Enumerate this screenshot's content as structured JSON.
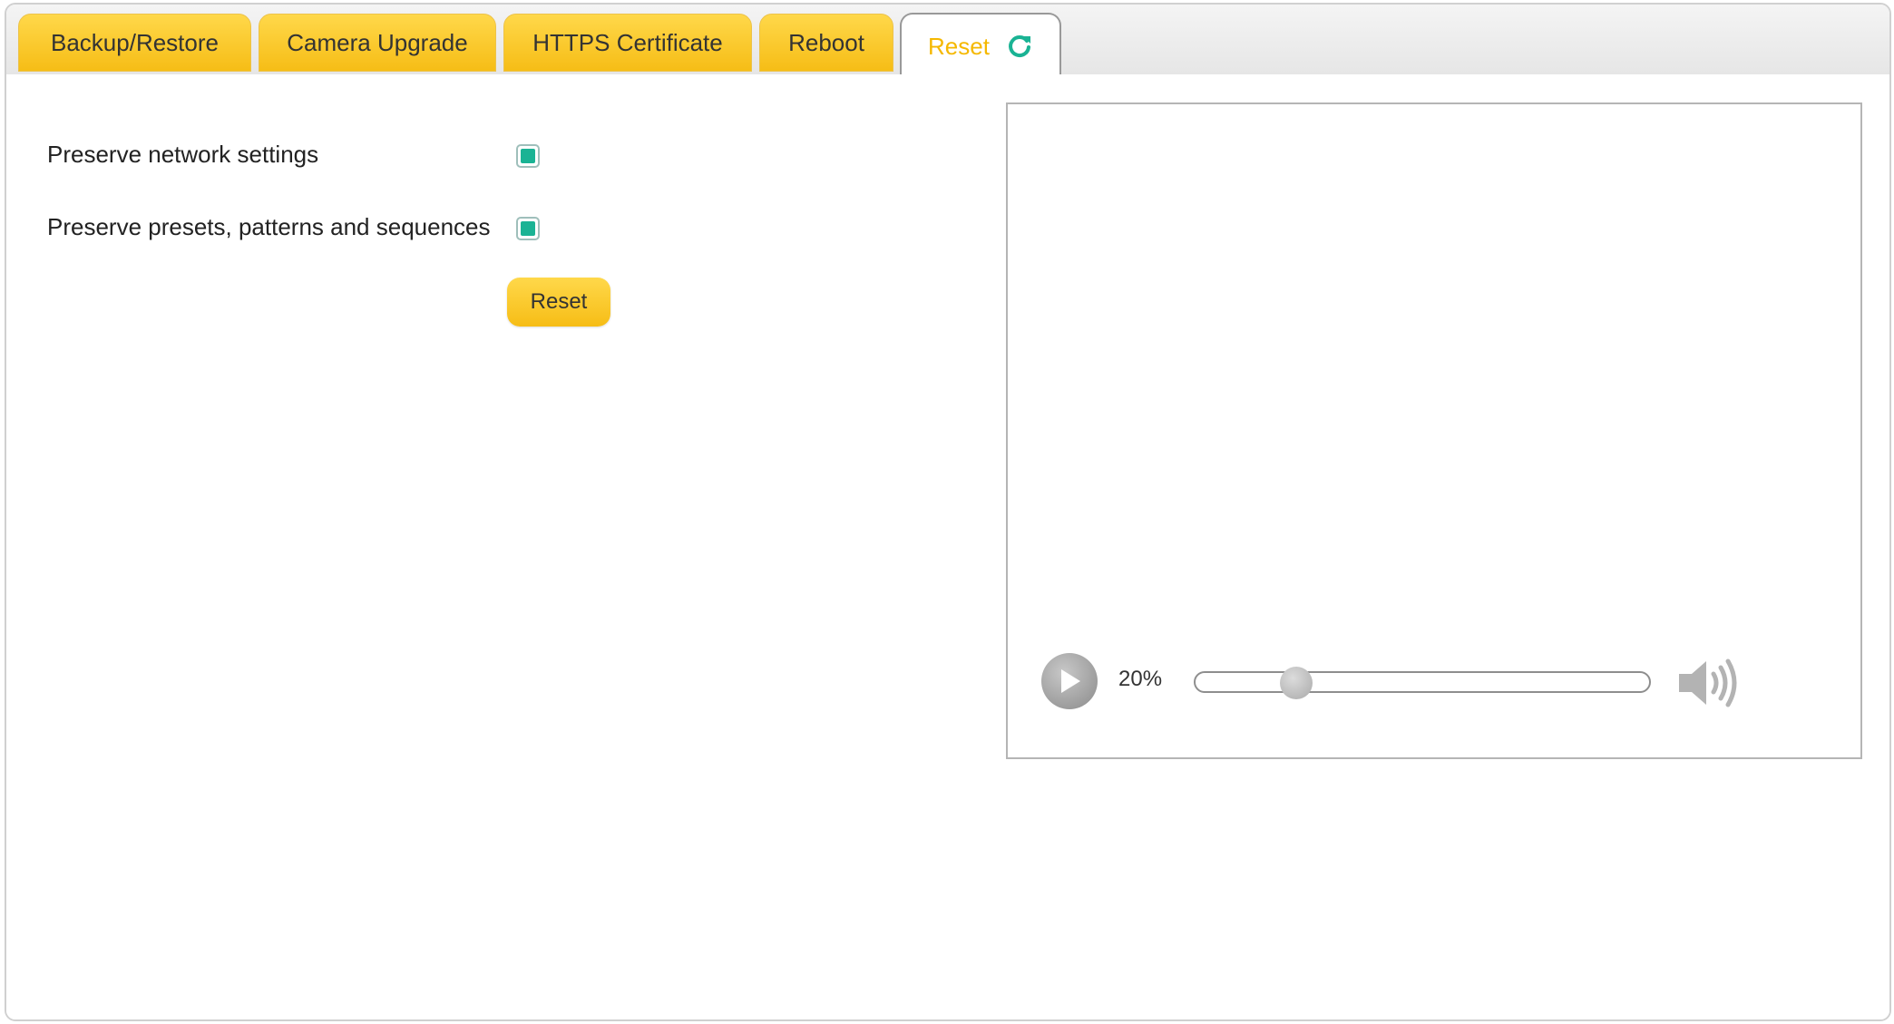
{
  "tabs": [
    {
      "label": "Backup/Restore"
    },
    {
      "label": "Camera Upgrade"
    },
    {
      "label": "HTTPS Certificate"
    },
    {
      "label": "Reboot"
    },
    {
      "label": "Reset",
      "active": true,
      "icon": "refresh-icon"
    }
  ],
  "reset_form": {
    "options": [
      {
        "label": "Preserve network settings",
        "checked": true
      },
      {
        "label": "Preserve presets, patterns and sequences",
        "checked": true
      }
    ],
    "button_label": "Reset"
  },
  "player": {
    "volume_text": "20%",
    "volume_level": 0.2,
    "play_icon": "play-icon",
    "speaker_icon": "speaker-icon"
  },
  "colors": {
    "accent_yellow": "#f6bd16",
    "check_teal": "#1ab394",
    "active_tab_text": "#f5b800"
  }
}
